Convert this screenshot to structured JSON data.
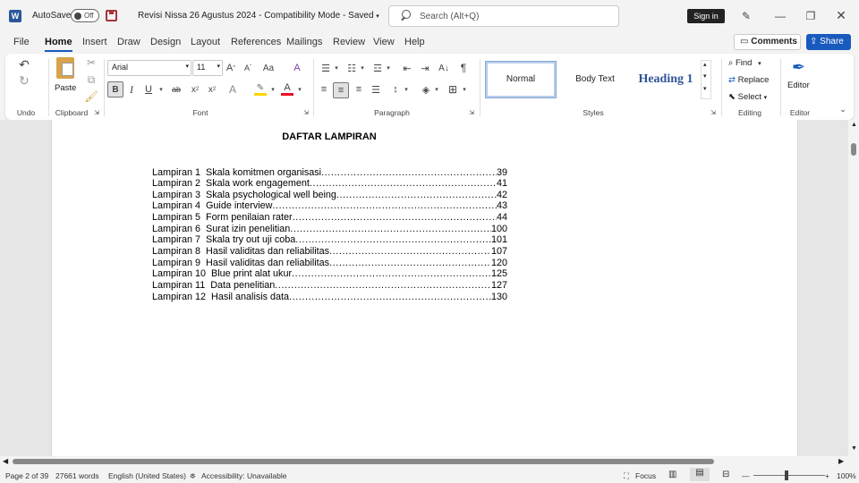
{
  "titlebar": {
    "autosave_label": "AutoSave",
    "autosave_state": "Off",
    "doc_title": "Revisi Nissa 26 Agustus 2024",
    "sep": "-",
    "mode": "Compatibility Mode",
    "sep2": "-",
    "status": "Saved",
    "search_placeholder": "Search (Alt+Q)",
    "signin_label": "Sign in"
  },
  "tabs": [
    "File",
    "Home",
    "Insert",
    "Draw",
    "Design",
    "Layout",
    "References",
    "Mailings",
    "Review",
    "View",
    "Help"
  ],
  "actions": {
    "comments_label": "Comments",
    "share_label": "Share"
  },
  "ribbon": {
    "groups": {
      "undo": "Undo",
      "clipboard": "Clipboard",
      "font": "Font",
      "paragraph": "Paragraph",
      "styles": "Styles",
      "editing": "Editing",
      "editor": "Editor"
    },
    "paste_label": "Paste",
    "font_name": "Arial",
    "font_size": "11",
    "styles": {
      "normal": "Normal",
      "body_text": "Body Text",
      "heading1": "Heading 1"
    },
    "editing": {
      "find": "Find",
      "replace": "Replace",
      "select": "Select"
    },
    "editor_label": "Editor",
    "bold_glyph": "B",
    "italic_glyph": "I",
    "underline_glyph": "U",
    "strike_glyph": "ab",
    "sub_glyph": "x",
    "sup_glyph": "x",
    "font_color_glyph": "A",
    "highlight_glyph": "ab",
    "pilcrow_glyph": "¶"
  },
  "document": {
    "heading": "DAFTAR LAMPIRAN",
    "entries": [
      {
        "label": "Lampiran 1",
        "title": "Skala komitmen organisasi",
        "page": "39"
      },
      {
        "label": "Lampiran 2",
        "title": "Skala work engagement",
        "page": "41"
      },
      {
        "label": "Lampiran 3",
        "title": "Skala psychological well being",
        "page": "42"
      },
      {
        "label": "Lampiran 4",
        "title": "Guide interview",
        "page": "43"
      },
      {
        "label": "Lampiran 5",
        "title": "Form penilaian rater",
        "page": "44"
      },
      {
        "label": "Lampiran 6",
        "title": "Surat izin penelitian",
        "page": "100"
      },
      {
        "label": "Lampiran 7",
        "title": "Skala try out uji coba",
        "page": "101"
      },
      {
        "label": "Lampiran 8",
        "title": "Hasil validitas dan reliabilitas",
        "page": "107"
      },
      {
        "label": "Lampiran 9",
        "title": "Hasil validitas dan reliabilitas",
        "page": "120"
      },
      {
        "label": "Lampiran 10",
        "title": "Blue print alat ukur",
        "page": "125"
      },
      {
        "label": "Lampiran 11",
        "title": "Data penelitian",
        "page": "127"
      },
      {
        "label": "Lampiran 12",
        "title": "Hasil analisis data",
        "page": "130"
      }
    ]
  },
  "statusbar": {
    "page": "Page 2 of 39",
    "words": "27661 words",
    "language": "English (United States)",
    "accessibility": "Accessibility: Unavailable",
    "focus": "Focus",
    "zoom": "100%"
  },
  "colors": {
    "accent": "#185abd",
    "word_blue": "#2b579a",
    "highlight": "#ffd400",
    "font_red": "#e81123"
  }
}
